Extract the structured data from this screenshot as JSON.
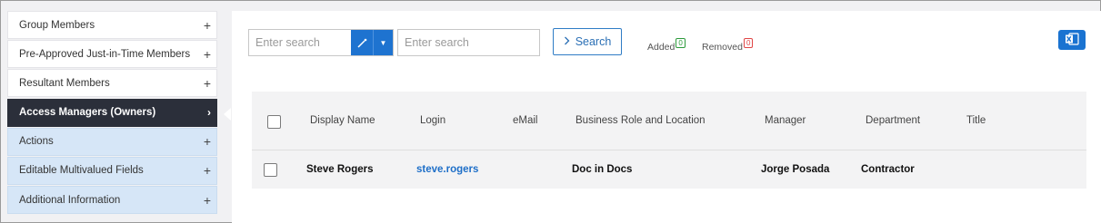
{
  "sidebar": {
    "items": [
      {
        "label": "Group Members",
        "toggle": "+"
      },
      {
        "label": "Pre-Approved Just-in-Time Members",
        "toggle": "+"
      },
      {
        "label": "Resultant Members",
        "toggle": "+"
      },
      {
        "label": "Access Managers (Owners)",
        "toggle": "›"
      },
      {
        "label": "Actions",
        "toggle": "+"
      },
      {
        "label": "Editable Multivalued Fields",
        "toggle": "+"
      },
      {
        "label": "Additional Information",
        "toggle": "+"
      }
    ]
  },
  "toolbar": {
    "search1_placeholder": "Enter search",
    "search2_placeholder": "Enter search",
    "search_button": "Search",
    "added_label": "Added",
    "added_count": "0",
    "removed_label": "Removed",
    "removed_count": "0"
  },
  "table": {
    "columns": [
      "Display Name",
      "Login",
      "eMail",
      "Business Role and Location",
      "Manager",
      "Department",
      "Title"
    ],
    "rows": [
      {
        "display_name": "Steve Rogers",
        "login": "steve.rogers",
        "email": "",
        "business_role": "Doc in Docs",
        "manager": "Jorge Posada",
        "department": "Contractor",
        "title": ""
      }
    ]
  },
  "colors": {
    "accent": "#1e73d0",
    "active_nav": "#2b2f3a",
    "nav_blue": "#d6e6f7"
  },
  "icons": {
    "excel": "excel-export-icon",
    "search": "chevron-right-icon"
  }
}
